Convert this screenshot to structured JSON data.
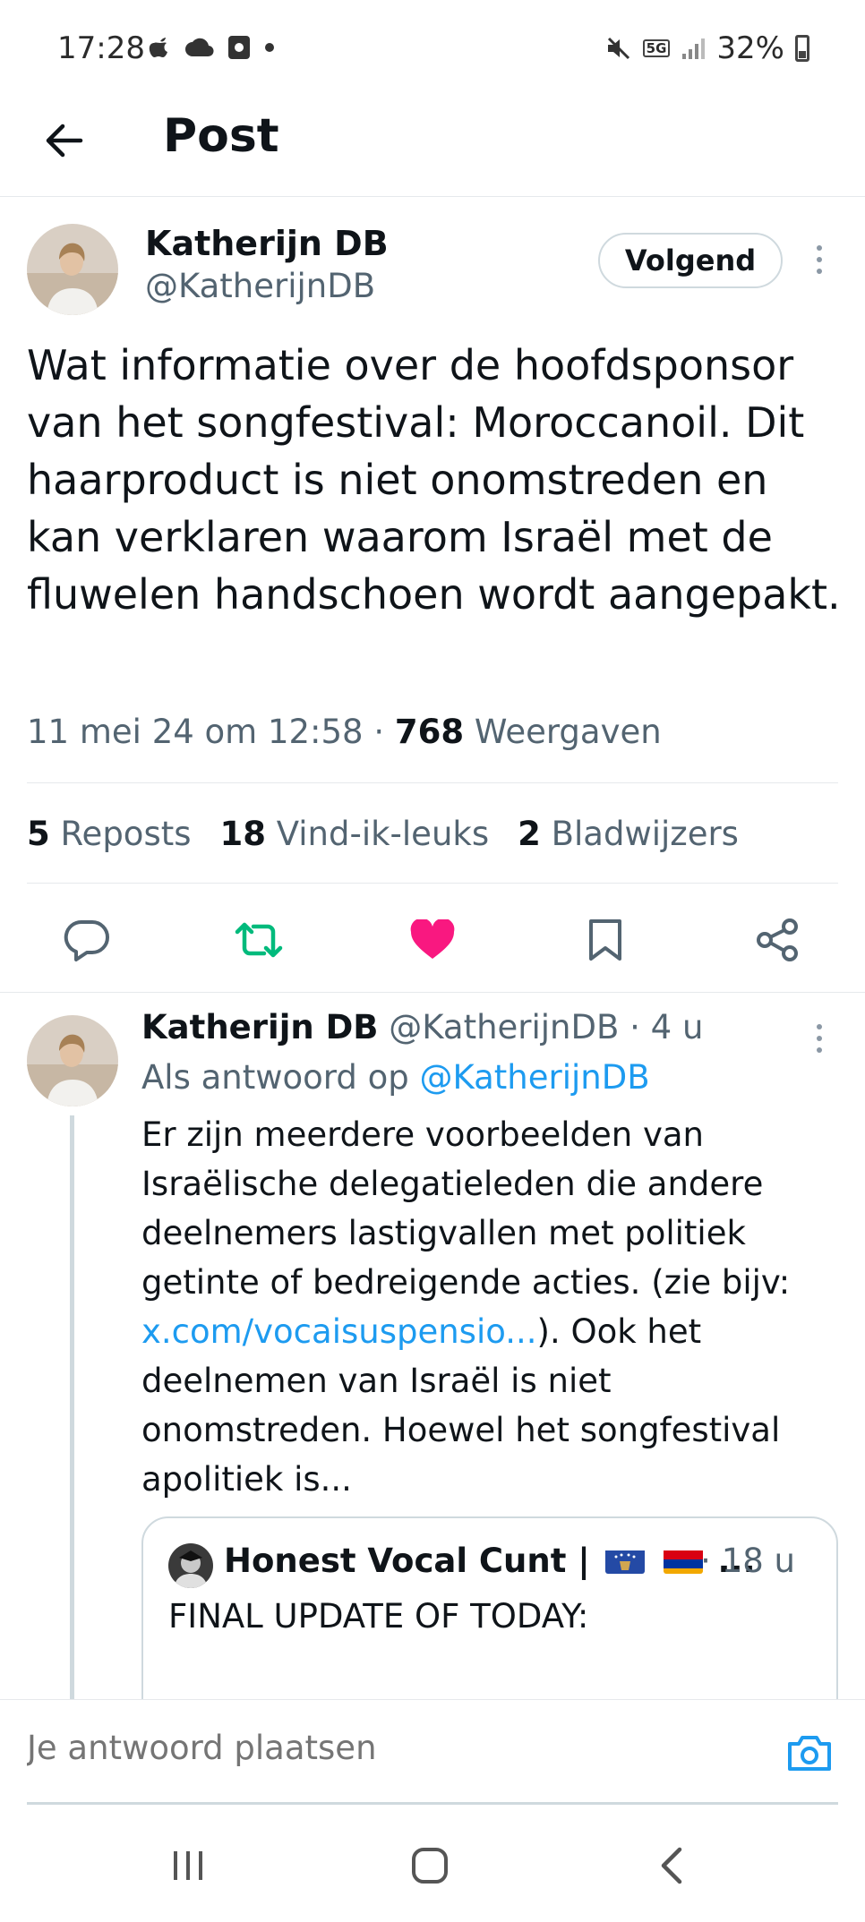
{
  "status_bar": {
    "time": "17:28",
    "network": "5G",
    "battery": "32%",
    "icons": [
      "apple-icon",
      "cloud-icon",
      "square-app-icon",
      "dot-icon",
      "mute-icon",
      "signal-icon",
      "battery-icon"
    ]
  },
  "header": {
    "title": "Post",
    "back_icon": "arrow-left-icon"
  },
  "post": {
    "author_name": "Katherijn DB",
    "author_handle": "@KatherijnDB",
    "follow_label": "Volgend",
    "text": "Wat informatie over de hoofdsponsor van het songfestival: Moroccanoil. Dit haarproduct is niet onomstreden en kan verklaren waarom Israël met de fluwelen handschoen wordt aangepakt.",
    "timestamp": "11 mei 24 om 12:58",
    "separator": "·",
    "views_count": "768",
    "views_label": "Weergaven",
    "stats": {
      "reposts_count": "5",
      "reposts_label": "Reposts",
      "likes_count": "18",
      "likes_label": "Vind-ik-leuks",
      "bookmarks_count": "2",
      "bookmarks_label": "Bladwijzers"
    },
    "actions": [
      "reply-icon",
      "repost-icon",
      "like-icon",
      "bookmark-icon",
      "share-icon"
    ],
    "colors": {
      "repost": "#00ba7c",
      "like": "#f91880",
      "link": "#1d9bf0"
    }
  },
  "reply": {
    "author_name": "Katherijn DB",
    "author_handle": "@KatherijnDB",
    "time": "· 4 u",
    "reply_to_prefix": "Als antwoord op",
    "reply_to_handle": "@KatherijnDB",
    "text_before_link": "Er zijn meerdere voorbeelden van Israëlische delegatieleden die andere deelnemers lastigvallen met politiek getinte of bedreigende acties. (zie bijv: ",
    "link_text": "x.com/vocaisuspensio...",
    "text_after_link": "). Ook het deelnemen van Israël is niet onomstreden. Hoewel het songfestival apolitiek is...",
    "quote": {
      "author_name": "Honest Vocal Cunt |",
      "name_suffix": "...",
      "time": "· 18 u",
      "text": "FINAL UPDATE OF TODAY:"
    }
  },
  "composer": {
    "placeholder": "Je antwoord plaatsen",
    "camera_icon": "camera-icon"
  },
  "navbar": {
    "buttons": [
      "recents-icon",
      "home-icon",
      "back-icon"
    ]
  }
}
